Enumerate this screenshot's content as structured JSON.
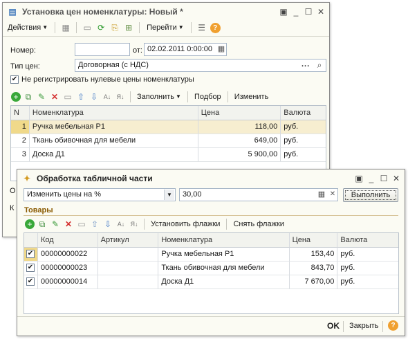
{
  "main_window": {
    "title": "Установка цен номенклатуры: Новый *",
    "toolbar": {
      "actions": "Действия",
      "goto": "Перейти",
      "help": "?"
    },
    "number_label": "Номер:",
    "number_value": "",
    "date_label": "от:",
    "date_value": "02.02.2011  0:00:00",
    "price_type_label": "Тип цен:",
    "price_type_value": "Договорная (с НДС)",
    "ellipsis": "...",
    "dont_register_zero": "Не регистрировать нулевые цены номенклатуры",
    "table_toolbar": {
      "fill": "Заполнить",
      "select": "Подбор",
      "change": "Изменить"
    },
    "table": {
      "headers": [
        "N",
        "Номенклатура",
        "Цена",
        "Валюта"
      ],
      "rows": [
        {
          "n": "1",
          "name": "Ручка мебельная Р1",
          "price": "118,00",
          "currency": "руб."
        },
        {
          "n": "2",
          "name": "Ткань обивочная для мебели",
          "price": "649,00",
          "currency": "руб."
        },
        {
          "n": "3",
          "name": "Доска Д1",
          "price": "5 900,00",
          "currency": "руб."
        }
      ]
    },
    "bottom_label_o": "О",
    "bottom_label_k": "К"
  },
  "dialog": {
    "title": "Обработка табличной части",
    "operation": "Изменить цены на %",
    "percent": "30,00",
    "execute": "Выполнить",
    "section": "Товары",
    "toolbar": {
      "set_flags": "Установить флажки",
      "clear_flags": "Снять флажки"
    },
    "table": {
      "headers": [
        "Код",
        "Артикул",
        "Номенклатура",
        "Цена",
        "Валюта"
      ],
      "rows": [
        {
          "checked": true,
          "code": "00000000022",
          "article": "",
          "name": "Ручка мебельная Р1",
          "price": "153,40",
          "currency": "руб."
        },
        {
          "checked": true,
          "code": "00000000023",
          "article": "",
          "name": "Ткань обивочная для мебели",
          "price": "843,70",
          "currency": "руб."
        },
        {
          "checked": true,
          "code": "00000000014",
          "article": "",
          "name": "Доска Д1",
          "price": "7 670,00",
          "currency": "руб."
        }
      ]
    },
    "ok": "OK",
    "close": "Закрыть",
    "help": "?"
  },
  "colors": {
    "window_bg": "#fbfbf3",
    "section_title": "#8a5a00",
    "selected_row": "#f7eed0"
  }
}
